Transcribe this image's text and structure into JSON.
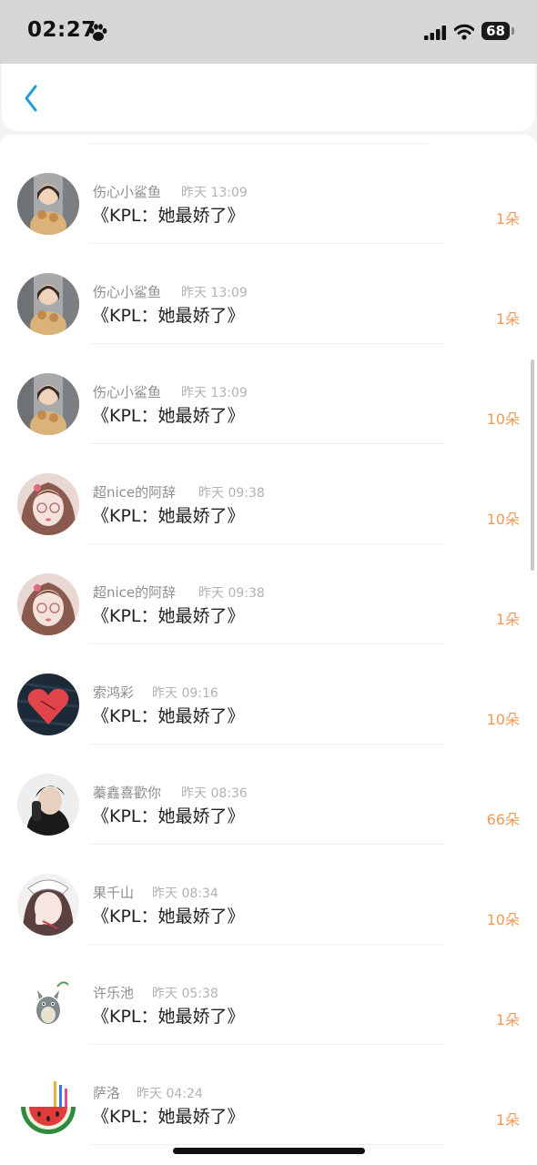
{
  "status_bar": {
    "time": "02:27",
    "battery_level": "68"
  },
  "header": {
    "back_icon": "chevron-left-icon",
    "accent_color": "#1e9bd7"
  },
  "colors": {
    "name": "#8e8e8e",
    "time": "#b2b2b2",
    "title": "#222222",
    "count": "#f09a56"
  },
  "records": [
    {
      "name": "伤心小鲨鱼",
      "time": "昨天 13:09",
      "title": "《KPL：她最娇了》",
      "count": "1朵"
    },
    {
      "name": "伤心小鲨鱼",
      "time": "昨天 13:09",
      "title": "《KPL：她最娇了》",
      "count": "1朵"
    },
    {
      "name": "伤心小鲨鱼",
      "time": "昨天 13:09",
      "title": "《KPL：她最娇了》",
      "count": "10朵"
    },
    {
      "name": "超nice的阿辞",
      "time": "昨天 09:38",
      "title": "《KPL：她最娇了》",
      "count": "10朵"
    },
    {
      "name": "超nice的阿辞",
      "time": "昨天 09:38",
      "title": "《KPL：她最娇了》",
      "count": "1朵"
    },
    {
      "name": "索鸿彩",
      "time": "昨天 09:16",
      "title": "《KPL：她最娇了》",
      "count": "10朵"
    },
    {
      "name": "蓁鑫喜歡你",
      "time": "昨天 08:36",
      "title": "《KPL：她最娇了》",
      "count": "66朵"
    },
    {
      "name": "果千山",
      "time": "昨天 08:34",
      "title": "《KPL：她最娇了》",
      "count": "10朵"
    },
    {
      "name": "许乐池",
      "time": "昨天 05:38",
      "title": "《KPL：她最娇了》",
      "count": "1朵"
    },
    {
      "name": "萨洛",
      "time": "昨天 04:24",
      "title": "《KPL：她最娇了》",
      "count": "1朵"
    }
  ]
}
